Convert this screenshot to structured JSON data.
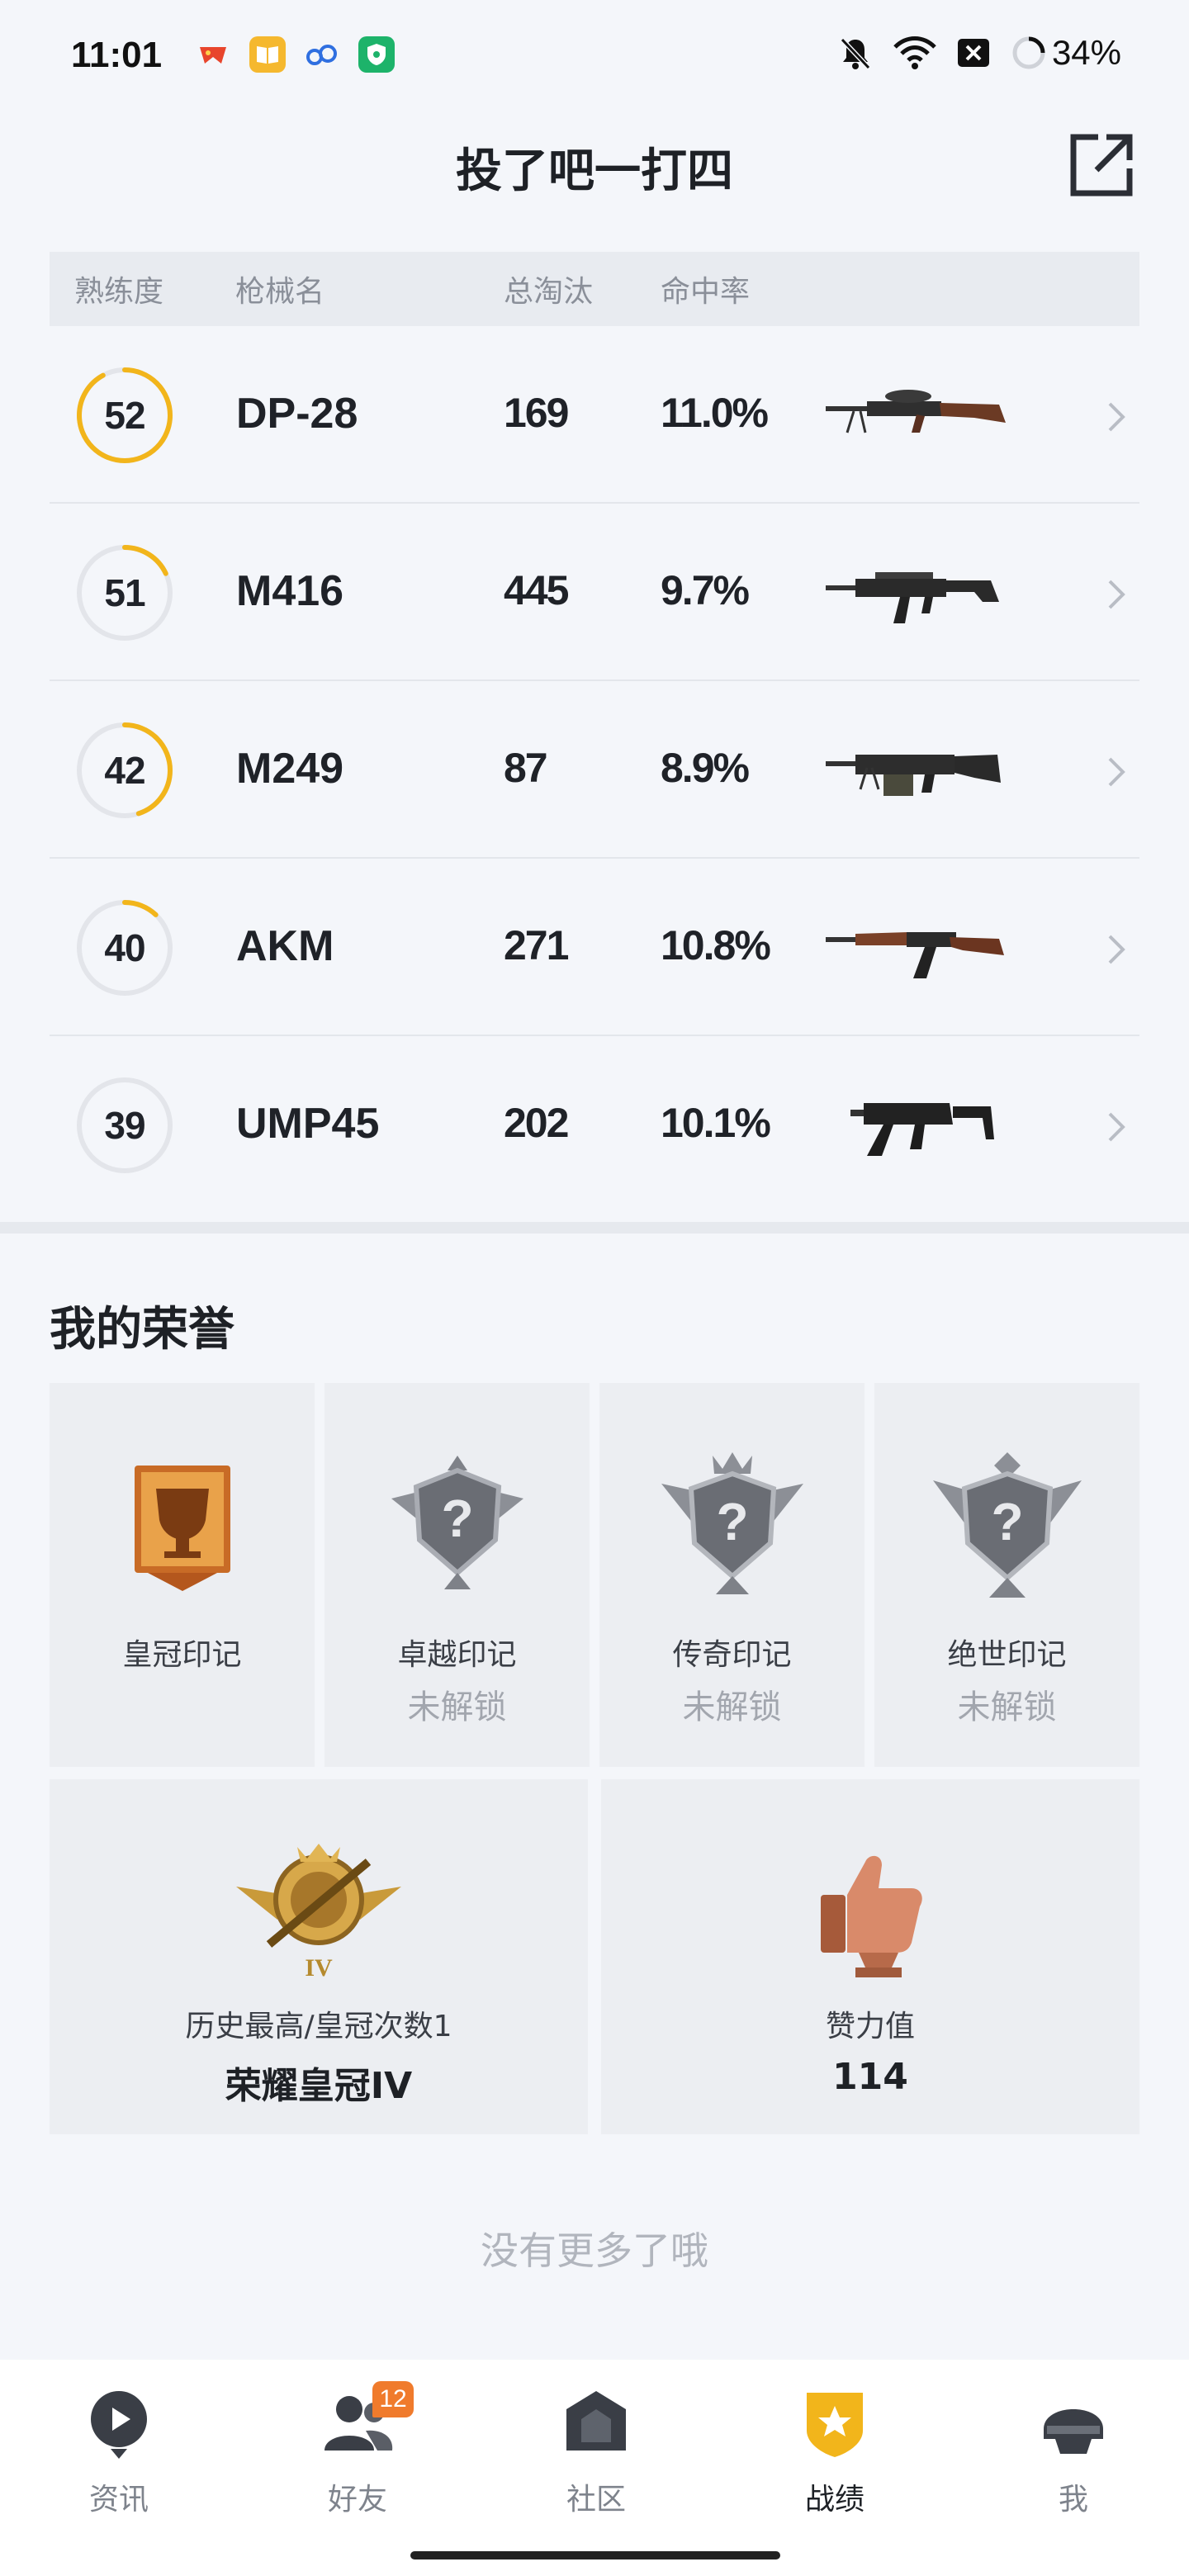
{
  "status_bar": {
    "time": "11:01",
    "battery": "34%",
    "icons": [
      "game-app-icon",
      "book-app-icon",
      "cloud-app-icon",
      "shield-app-icon",
      "mute-icon",
      "wifi-icon",
      "close-box-icon",
      "loading-ring-icon"
    ]
  },
  "header": {
    "title": "投了吧一打四",
    "share_icon": "share-out-icon"
  },
  "table": {
    "headers": {
      "proficiency": "熟练度",
      "name": "枪械名",
      "kills": "总淘汰",
      "accuracy": "命中率"
    },
    "rows": [
      {
        "proficiency": "52",
        "progress": 0.92,
        "name": "DP-28",
        "kills": "169",
        "accuracy": "11.0%",
        "gun": "dp28"
      },
      {
        "proficiency": "51",
        "progress": 0.18,
        "name": "M416",
        "kills": "445",
        "accuracy": "9.7%",
        "gun": "m416"
      },
      {
        "proficiency": "42",
        "progress": 0.45,
        "name": "M249",
        "kills": "87",
        "accuracy": "8.9%",
        "gun": "m249"
      },
      {
        "proficiency": "40",
        "progress": 0.12,
        "name": "AKM",
        "kills": "271",
        "accuracy": "10.8%",
        "gun": "akm"
      },
      {
        "proficiency": "39",
        "progress": 0.0,
        "name": "UMP45",
        "kills": "202",
        "accuracy": "10.1%",
        "gun": "ump45"
      }
    ]
  },
  "honors": {
    "title": "我的荣誉",
    "badges": [
      {
        "label": "皇冠印记",
        "sub": "",
        "icon": "crown-trophy-badge-icon"
      },
      {
        "label": "卓越印记",
        "sub": "未解锁",
        "icon": "locked-excellence-badge-icon"
      },
      {
        "label": "传奇印记",
        "sub": "未解锁",
        "icon": "locked-legend-badge-icon"
      },
      {
        "label": "绝世印记",
        "sub": "未解锁",
        "icon": "locked-peerless-badge-icon"
      }
    ],
    "rank": {
      "label": "历史最高/皇冠次数1",
      "value": "荣耀皇冠IV",
      "icon": "crown-rank-emblem-icon",
      "rank_mark": "IV"
    },
    "likes": {
      "label": "赞力值",
      "value": "114",
      "icon": "thumbs-up-trophy-icon"
    }
  },
  "footer_text": "没有更多了哦",
  "nav": [
    {
      "label": "资讯",
      "icon": "news-play-icon",
      "active": false,
      "badge": ""
    },
    {
      "label": "好友",
      "icon": "friends-icon",
      "active": false,
      "badge": "12"
    },
    {
      "label": "社区",
      "icon": "community-house-icon",
      "active": false,
      "badge": ""
    },
    {
      "label": "战绩",
      "icon": "record-shield-star-icon",
      "active": true,
      "badge": ""
    },
    {
      "label": "我",
      "icon": "helmet-profile-icon",
      "active": false,
      "badge": ""
    }
  ],
  "colors": {
    "accent_yellow": "#f2b51b",
    "ring_track": "#e3e5ea",
    "badge_orange": "#f07b2c"
  }
}
